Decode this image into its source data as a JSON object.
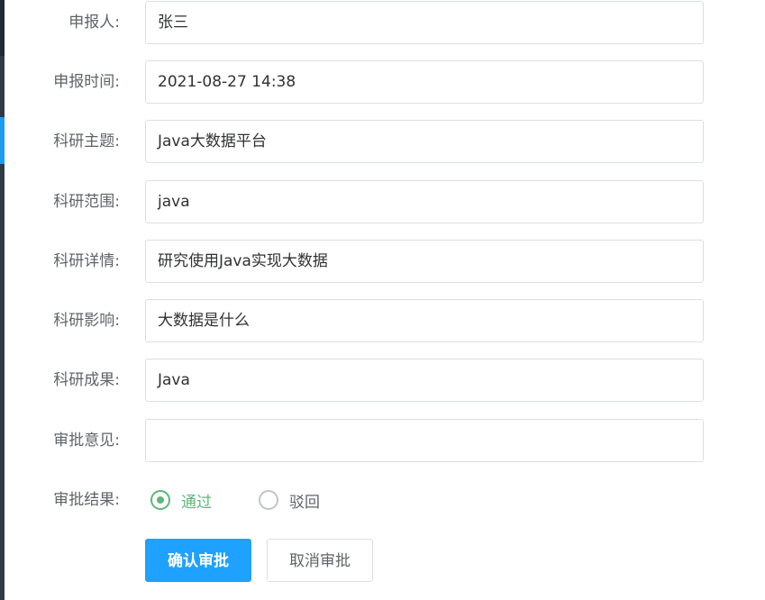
{
  "form": {
    "fields": [
      {
        "label": "申报人:",
        "value": "张三"
      },
      {
        "label": "申报时间:",
        "value": "2021-08-27 14:38"
      },
      {
        "label": "科研主题:",
        "value": "Java大数据平台"
      },
      {
        "label": "科研范围:",
        "value": "java"
      },
      {
        "label": "科研详情:",
        "value": "研究使用Java实现大数据"
      },
      {
        "label": "科研影响:",
        "value": "大数据是什么"
      },
      {
        "label": "科研成果:",
        "value": "Java"
      },
      {
        "label": "审批意见:",
        "value": ""
      }
    ],
    "result": {
      "label": "审批结果:",
      "options": [
        {
          "label": "通过",
          "checked": true
        },
        {
          "label": "驳回",
          "checked": false
        }
      ]
    },
    "buttons": {
      "confirm": "确认审批",
      "cancel": "取消审批"
    }
  },
  "colors": {
    "primary": "#1ea1ff",
    "success": "#5cb87a",
    "border": "#dcdfe6",
    "label": "#5f6368"
  }
}
